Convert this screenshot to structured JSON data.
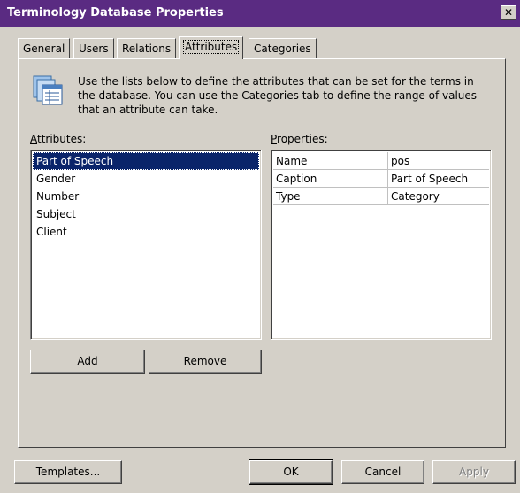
{
  "window": {
    "title": "Terminology Database Properties",
    "close_glyph": "✕"
  },
  "tabs": [
    {
      "label": "General",
      "active": false
    },
    {
      "label": "Users",
      "active": false
    },
    {
      "label": "Relations",
      "active": false
    },
    {
      "label": "Attributes",
      "active": true
    },
    {
      "label": "Categories",
      "active": false
    }
  ],
  "description": "Use the lists below to define the attributes that can be set for the terms in the database. You can use the Categories tab to define the range of values that an attribute can take.",
  "info_icon": "properties-list-icon",
  "attributes": {
    "label_mnemonic": "A",
    "label_rest": "ttributes:",
    "items": [
      "Part of Speech",
      "Gender",
      "Number",
      "Subject",
      "Client"
    ],
    "selected": "Part of Speech"
  },
  "properties": {
    "label_mnemonic": "P",
    "label_rest": "roperties:",
    "rows": [
      {
        "name": "Name",
        "value": "pos"
      },
      {
        "name": "Caption",
        "value": "Part of Speech"
      },
      {
        "name": "Type",
        "value": "Category"
      }
    ]
  },
  "buttons": {
    "add_mnemonic": "A",
    "add_rest": "dd",
    "remove_mnemonic": "R",
    "remove_rest": "emove",
    "templates": "Templates...",
    "ok": "OK",
    "cancel": "Cancel",
    "apply": "Apply"
  },
  "colors": {
    "title_bar": "#5a2b82",
    "selection": "#0a246a",
    "face": "#d4d0c8"
  }
}
